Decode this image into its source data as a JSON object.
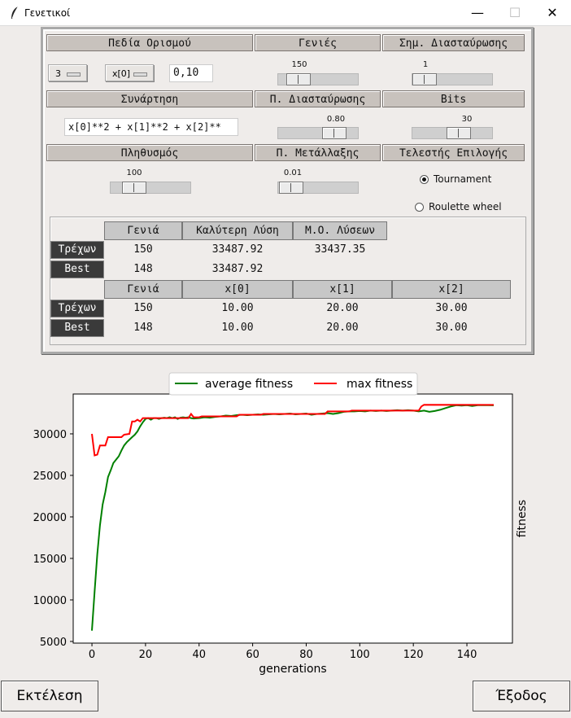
{
  "window": {
    "title": "Γενετικοί",
    "minimize": "—",
    "maximize": "☐",
    "close": "✕"
  },
  "headers": {
    "domains": "Πεδία Ορισμού",
    "generations": "Γενιές",
    "crossover_points": "Σημ. Διασταύρωσης",
    "function": "Συνάρτηση",
    "crossover_prob": "Π. Διασταύρωσης",
    "bits": "Bits",
    "population": "Πληθυσμός",
    "mutation_prob": "Π. Μετάλλαξης",
    "selection": "Τελεστής Επιλογής"
  },
  "controls": {
    "var_count": "3",
    "var_select": "x[0]",
    "domain_value": "0,10",
    "function_text": "x[0]**2 + x[1]**2 + x[2]**",
    "generations": {
      "value": "150",
      "fraction": 0.15
    },
    "crossover_points": {
      "value": "1",
      "fraction": 0.0
    },
    "crossover_prob": {
      "value": "0.80",
      "fraction": 0.8
    },
    "bits": {
      "value": "30",
      "fraction": 0.62
    },
    "population": {
      "value": "100",
      "fraction": 0.2
    },
    "mutation_prob": {
      "value": "0.01",
      "fraction": 0.01
    },
    "selection_options": [
      "Tournament",
      "Roulette wheel"
    ],
    "selection_selected": "Tournament"
  },
  "results": {
    "headers1": [
      "Γενιά",
      "Καλύτερη Λύση",
      "Μ.Ο. Λύσεων"
    ],
    "current_label": "Τρέχων",
    "best_label": "Best",
    "current1": [
      "150",
      "33487.92",
      "33437.35"
    ],
    "best1": [
      "148",
      "33487.92",
      ""
    ],
    "headers2": [
      "Γενιά",
      "x[0]",
      "x[1]",
      "x[2]"
    ],
    "current2": [
      "150",
      "10.00",
      "20.00",
      "30.00"
    ],
    "best2": [
      "148",
      "10.00",
      "20.00",
      "30.00"
    ]
  },
  "chart_data": {
    "type": "line",
    "xlabel": "generations",
    "ylabel": "fitness",
    "xlim": [
      -7,
      157
    ],
    "ylim": [
      4800,
      34800
    ],
    "xticks": [
      0,
      20,
      40,
      60,
      80,
      100,
      120,
      140
    ],
    "yticks": [
      5000,
      10000,
      15000,
      20000,
      25000,
      30000
    ],
    "legend": "top-center",
    "series": [
      {
        "name": "average fitness",
        "color": "#008000",
        "points": [
          [
            0,
            6300
          ],
          [
            1,
            11000
          ],
          [
            2,
            15500
          ],
          [
            3,
            19000
          ],
          [
            4,
            21500
          ],
          [
            5,
            23000
          ],
          [
            6,
            24800
          ],
          [
            7,
            25600
          ],
          [
            8,
            26500
          ],
          [
            9,
            26900
          ],
          [
            10,
            27300
          ],
          [
            11,
            28000
          ],
          [
            12,
            28600
          ],
          [
            13,
            29000
          ],
          [
            14,
            29300
          ],
          [
            15,
            29600
          ],
          [
            16,
            29900
          ],
          [
            17,
            30300
          ],
          [
            18,
            30900
          ],
          [
            19,
            31400
          ],
          [
            20,
            31800
          ],
          [
            21,
            31900
          ],
          [
            22,
            31700
          ],
          [
            23,
            31900
          ],
          [
            24,
            31900
          ],
          [
            25,
            31800
          ],
          [
            26,
            31900
          ],
          [
            27,
            31950
          ],
          [
            28,
            31900
          ],
          [
            29,
            32000
          ],
          [
            30,
            31900
          ],
          [
            31,
            32000
          ],
          [
            32,
            31800
          ],
          [
            33,
            31950
          ],
          [
            34,
            32000
          ],
          [
            35,
            31950
          ],
          [
            36,
            32000
          ],
          [
            37,
            31900
          ],
          [
            38,
            31850
          ],
          [
            40,
            31900
          ],
          [
            42,
            32000
          ],
          [
            44,
            31950
          ],
          [
            46,
            32050
          ],
          [
            48,
            32100
          ],
          [
            50,
            32200
          ],
          [
            52,
            32150
          ],
          [
            54,
            32250
          ],
          [
            56,
            32300
          ],
          [
            58,
            32250
          ],
          [
            60,
            32300
          ],
          [
            62,
            32350
          ],
          [
            64,
            32300
          ],
          [
            66,
            32350
          ],
          [
            68,
            32400
          ],
          [
            70,
            32350
          ],
          [
            72,
            32400
          ],
          [
            74,
            32450
          ],
          [
            76,
            32350
          ],
          [
            78,
            32400
          ],
          [
            80,
            32450
          ],
          [
            82,
            32300
          ],
          [
            84,
            32400
          ],
          [
            86,
            32450
          ],
          [
            88,
            32500
          ],
          [
            90,
            32400
          ],
          [
            92,
            32500
          ],
          [
            94,
            32650
          ],
          [
            96,
            32700
          ],
          [
            98,
            32700
          ],
          [
            100,
            32750
          ],
          [
            102,
            32700
          ],
          [
            104,
            32800
          ],
          [
            106,
            32750
          ],
          [
            108,
            32800
          ],
          [
            110,
            32750
          ],
          [
            112,
            32800
          ],
          [
            114,
            32850
          ],
          [
            116,
            32800
          ],
          [
            118,
            32850
          ],
          [
            120,
            32800
          ],
          [
            122,
            32700
          ],
          [
            124,
            32800
          ],
          [
            126,
            32650
          ],
          [
            128,
            32750
          ],
          [
            130,
            32900
          ],
          [
            132,
            33100
          ],
          [
            134,
            33300
          ],
          [
            136,
            33450
          ],
          [
            138,
            33400
          ],
          [
            140,
            33450
          ],
          [
            142,
            33350
          ],
          [
            144,
            33450
          ],
          [
            146,
            33450
          ],
          [
            148,
            33450
          ],
          [
            150,
            33437
          ]
        ]
      },
      {
        "name": "max fitness",
        "color": "#ff0000",
        "points": [
          [
            0,
            30000
          ],
          [
            1,
            27400
          ],
          [
            2,
            27500
          ],
          [
            3,
            28600
          ],
          [
            5,
            28600
          ],
          [
            6,
            29600
          ],
          [
            11,
            29600
          ],
          [
            12,
            29900
          ],
          [
            14,
            30000
          ],
          [
            15,
            31500
          ],
          [
            16,
            31500
          ],
          [
            17,
            31700
          ],
          [
            18,
            31500
          ],
          [
            19,
            31900
          ],
          [
            36,
            31900
          ],
          [
            37,
            32400
          ],
          [
            38,
            32000
          ],
          [
            40,
            32000
          ],
          [
            41,
            32100
          ],
          [
            54,
            32100
          ],
          [
            55,
            32300
          ],
          [
            63,
            32300
          ],
          [
            64,
            32400
          ],
          [
            87,
            32400
          ],
          [
            88,
            32700
          ],
          [
            96,
            32700
          ],
          [
            97,
            32800
          ],
          [
            122,
            32800
          ],
          [
            123,
            33300
          ],
          [
            124,
            33500
          ],
          [
            150,
            33488
          ]
        ]
      }
    ]
  },
  "buttons": {
    "run": "Εκτέλεση",
    "exit": "Έξοδος"
  }
}
